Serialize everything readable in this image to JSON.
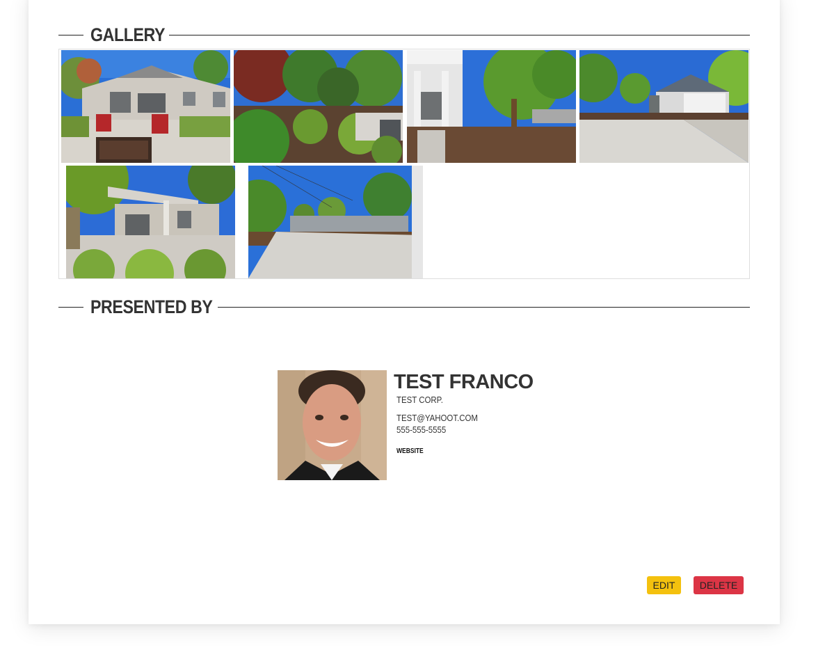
{
  "gallery": {
    "heading": "GALLERY",
    "photos": [
      {
        "alt": "backyard-patio-with-red-chairs-icon"
      },
      {
        "alt": "landscaped-garden-icon"
      },
      {
        "alt": "front-porch-with-tree-icon"
      },
      {
        "alt": "house-with-garage-driveway-icon"
      },
      {
        "alt": "covered-patio-with-grasses-icon"
      },
      {
        "alt": "driveway-and-street-view-icon"
      }
    ]
  },
  "presented_by": {
    "heading": "PRESENTED BY",
    "agent": {
      "name": "TEST FRANCO",
      "company": "TEST CORP.",
      "email": "TEST@YAHOOT.COM",
      "phone": "555-555-5555",
      "website_label": "WEBSITE"
    }
  },
  "actions": {
    "edit_label": "EDIT",
    "delete_label": "DELETE"
  },
  "colors": {
    "edit": "#f4c10e",
    "delete": "#dc3545",
    "heading_text": "#333333"
  }
}
